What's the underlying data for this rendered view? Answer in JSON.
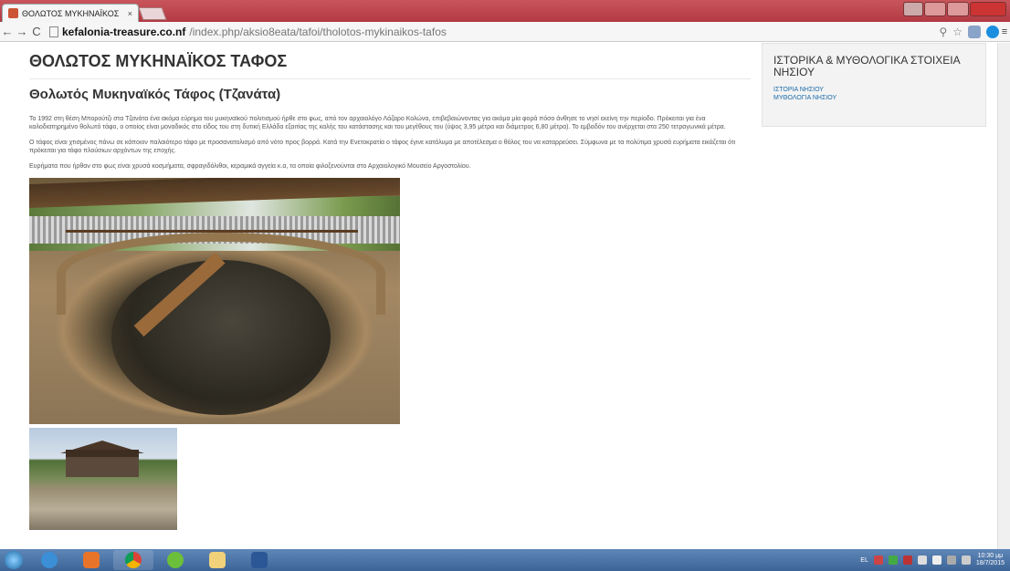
{
  "browser": {
    "tab_title": "ΘΟΛΩΤΟΣ ΜΥΚΗΝΑΪΚΟΣ",
    "tab_close": "×",
    "url_host": "kefalonia-treasure.co.nf",
    "url_path": "/index.php/aksio8eata/tafoi/tholotos-mykinaikos-tafos",
    "back": "←",
    "forward": "→",
    "reload": "C",
    "menu": "≡"
  },
  "main": {
    "page_title": "ΘΟΛΩΤΟΣ ΜΥΚΗΝΑΪΚΟΣ ΤΑΦΟΣ",
    "article_title": "Θολωτός Μυκηναϊκός Τάφος (Τζανάτα)",
    "paragraphs": [
      "Το 1992 στη θέση Μπορούτζι στα Τζανάτα ένα ακόμα εύρημα του μυκηναϊκού πολιτισμού ήρθε στο φως, από τον αρχαιολόγο Λάζαρο Κολώνα, επιβεβαιώνοντας για ακόμα μία φορά πόσο άνθησε το νησί εκείνη την περίοδο. Πρόκειται για ένα καλοδιατηρημένο θολωτό τάφο, ο οποίος είναι μοναδικός στο είδος του στη δυτική Ελλάδα εξαιτίας της καλής του κατάστασης και του μεγέθους του (ύψος 3,95 μέτρα και διάμετρος 6,80 μέτρα). Το εμβαδόν του ανέρχεται στα 250 τετραγωνικά μέτρα.",
      "Ο τάφος είναι χτισμένος πάνω σε κάποιον παλαιότερο τάφο με προσανατολισμό από νότο προς βορρά. Κατά την Ενετοκρατία ο τάφος έγινε κατάλυμα με αποτέλεσμα ο θόλος του να καταρρεύσει. Σύμφωνα με τα πολύτιμα χρυσά ευρήματα εικάζεται ότι πρόκειται για τάφο πλούσιων αρχόντων της εποχής.",
      "Ευρήματα που ήρθαν στο φως είναι χρυσά κοσμήματα, σφραγιδόλιθοι, κεραμικά αγγεία κ.α, τα οποία φιλοξενούνται στο Αρχαιολογικό Μουσείο Αργοστολίου."
    ]
  },
  "sidebar": {
    "title": "ΙΣΤΟΡΙΚΑ & ΜΥΘΟΛΟΓΙΚΑ ΣΤΟΙΧΕΙΑ ΝΗΣΙΟΥ",
    "links": [
      "ΙΣΤΟΡΙΑ ΝΗΣΙΟΥ",
      "ΜΥΘΟΛΟΓΙΑ ΝΗΣΙΟΥ"
    ]
  },
  "taskbar": {
    "language": "EL",
    "time": "10:30 μμ",
    "date": "18/7/2015"
  },
  "colors": {
    "link": "#1a6aa8",
    "tab_strip": "#b23a44",
    "taskbar": "#3c6496"
  }
}
